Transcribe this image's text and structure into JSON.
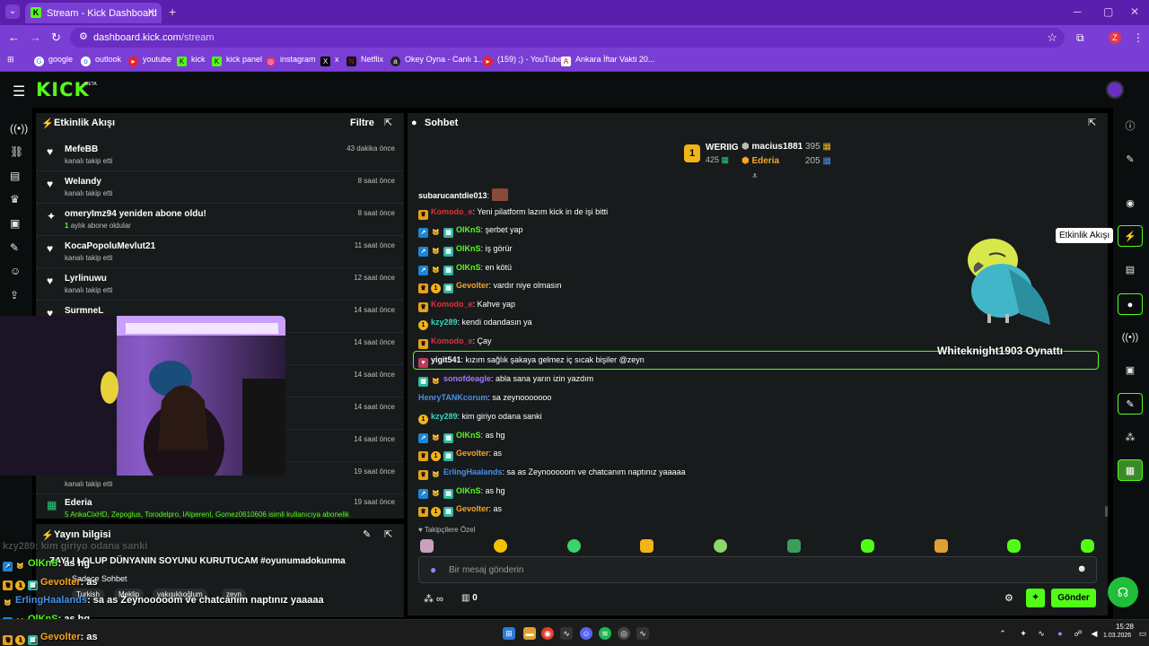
{
  "browser": {
    "tab_title": "Stream - Kick Dashboard",
    "url_host": "dashboard.kick.com",
    "url_path": "/stream",
    "profile_initial": "Z",
    "bookmarks": [
      "google",
      "outlook",
      "youtube",
      "kick",
      "kick panel",
      "instagram",
      "x",
      "Netflix",
      "Okey Oyna - Canlı 1...",
      "(159) ;) - YouTube",
      "Ankara İftar Vakti 20..."
    ]
  },
  "app": {
    "logo": "KICK",
    "beta": "BETA"
  },
  "activity": {
    "title": "Etkinlik Akışı",
    "filter": "Filtre",
    "items": [
      {
        "name": "MefeBB",
        "sub": "kanalı takip etti",
        "time": "43 dakika önce"
      },
      {
        "name": "Welandy",
        "sub": "kanalı takip etti",
        "time": "8 saat önce"
      },
      {
        "name": "omeryImz94 yeniden abone oldu!",
        "sub_count": "1",
        "sub": "aylık abone oldular",
        "time": "8 saat önce"
      },
      {
        "name": "KocaPopoluMevlut21",
        "sub": "kanalı takip etti",
        "time": "11 saat önce"
      },
      {
        "name": "Lyrlinuwu",
        "sub": "kanalı takip etti",
        "time": "12 saat önce"
      },
      {
        "name": "SurmneL",
        "sub": "",
        "time": "14 saat önce"
      },
      {
        "name": "",
        "sub": "",
        "time": "14 saat önce"
      },
      {
        "name": "",
        "sub": "",
        "time": "14 saat önce"
      },
      {
        "name": "",
        "sub": "",
        "time": "14 saat önce"
      },
      {
        "name": "",
        "sub": "",
        "time": "14 saat önce"
      },
      {
        "name": "",
        "sub": "kanalı takip etti",
        "time": "19 saat önce"
      },
      {
        "name": "Ederia",
        "sub": "5 AnkaCixHD, Zepoglus, Torodelpro, IAlperenI, Gomez0610606 isimli kullanıcıya abonelik",
        "time": "19 saat önce"
      }
    ]
  },
  "stream_info": {
    "title": "Yayın bilgisi",
    "stream_title": "ZAYLI LOLUP DÜNYANIN SOYUNU KURUTUCAM #oyunumadokunma",
    "mode": "Sadece Sohbet",
    "tags": [
      "Turkish",
      "Meklip",
      "yakışıklıoğlum",
      "zeyn"
    ]
  },
  "chat": {
    "title": "Sohbet",
    "leaderboard": {
      "rank": "1",
      "first_name": "WERIIG",
      "first_value": "425",
      "second_name": "macius1881",
      "second_value": "395",
      "third_name": "Ederia",
      "third_value": "205"
    },
    "messages": [
      {
        "user": "subarucantdie013",
        "text": "",
        "badges": [],
        "color": "white"
      },
      {
        "user": "Komodo_e",
        "text": "Yeni pilatform lazım kick in de işi bitti",
        "badges": [
          "crown"
        ],
        "color": "red"
      },
      {
        "user": "OlKnS",
        "text": "şerbet yap",
        "badges": [
          "pick",
          "cat",
          "gift"
        ],
        "color": "green"
      },
      {
        "user": "OlKnS",
        "text": "iş görür",
        "badges": [
          "pick",
          "cat",
          "gift"
        ],
        "color": "green"
      },
      {
        "user": "OlKnS",
        "text": "en kötü",
        "badges": [
          "pick",
          "cat",
          "gift"
        ],
        "color": "green"
      },
      {
        "user": "Gevolter",
        "text": "vardır niye olmasın",
        "badges": [
          "crown",
          "coin",
          "gift"
        ],
        "color": "orange"
      },
      {
        "user": "Komodo_e",
        "text": "Kahve yap",
        "badges": [
          "crown"
        ],
        "color": "red"
      },
      {
        "user": "kzy289",
        "text": "kendi odandasın ya",
        "badges": [
          "coin"
        ],
        "color": "teal"
      },
      {
        "user": "Komodo_e",
        "text": "Çay",
        "badges": [
          "crown"
        ],
        "color": "red"
      },
      {
        "user": "yigit541",
        "text": "kızım sağlık şakaya gelmez iç sıcak bişiler @zeyn",
        "badges": [
          "gift"
        ],
        "color": "white"
      },
      {
        "user": "sonofdeagle",
        "text": "abla sana yarın izin yazdım",
        "badges": [
          "gift",
          "cat"
        ],
        "color": "purple"
      },
      {
        "user": "HenryTANKcorum",
        "text": "sa zeynooooooo",
        "badges": [],
        "color": "blue"
      },
      {
        "user": "kzy289",
        "text": "kim giriyo odana sanki",
        "badges": [
          "coin"
        ],
        "color": "teal"
      },
      {
        "user": "OlKnS",
        "text": "as hg",
        "badges": [
          "pick",
          "cat",
          "gift"
        ],
        "color": "green"
      },
      {
        "user": "Gevolter",
        "text": "as",
        "badges": [
          "crown",
          "coin",
          "gift"
        ],
        "color": "orange"
      },
      {
        "user": "ErlingHaalands",
        "text": "sa as Zeynooooom ve chatcanım naptınız yaaaaa",
        "badges": [
          "crown",
          "cat"
        ],
        "color": "blue"
      },
      {
        "user": "OlKnS",
        "text": "as hg",
        "badges": [
          "pick",
          "cat",
          "gift"
        ],
        "color": "green"
      },
      {
        "user": "Gevolter",
        "text": "as",
        "badges": [
          "crown",
          "coin",
          "gift"
        ],
        "color": "orange"
      }
    ],
    "overlay_name": "Whiteknight1903 Oynattı",
    "followers_only": "Takipçilere Özel",
    "input_placeholder": "Bir mesaj gönderin",
    "points": "0",
    "send": "Gönder"
  },
  "overlay_chat": [
    {
      "user": "kzy289",
      "text": ": kim giriyo odana sanki"
    },
    {
      "user": "OlKnS",
      "text": ": as hg"
    },
    {
      "user": "Gevolter",
      "text": ": as"
    },
    {
      "user": "ErlingHaalands",
      "text": ": sa as Zeynooooom ve chatcanım naptınız yaaaaa"
    },
    {
      "user": "OlKnS",
      "text": ": as hg"
    },
    {
      "user": "Gevolter",
      "text": ": as"
    }
  ],
  "tooltip": "Etkinlik Akışı",
  "taskbar": {
    "time": "15:28",
    "date": "1.03.2026"
  },
  "colors": {
    "kick_green": "#53fc18",
    "chrome_purple": "#7b3ed4",
    "panel_bg": "#181b1c"
  }
}
